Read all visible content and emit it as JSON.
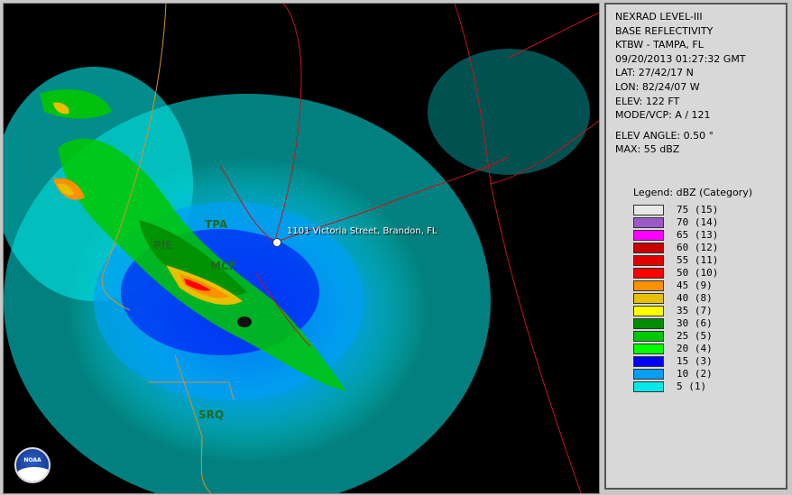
{
  "info": {
    "lines_top": [
      "NEXRAD LEVEL-III",
      "BASE REFLECTIVITY",
      "KTBW - TAMPA, FL",
      "09/20/2013 01:27:32 GMT",
      "LAT: 27/42/17 N",
      "LON: 82/24/07 W",
      "ELEV: 122 FT",
      "MODE/VCP: A / 121"
    ],
    "lines_bottom": [
      "ELEV ANGLE: 0.50 °",
      "MAX: 55 dBZ"
    ]
  },
  "legend": {
    "title": "Legend: dBZ (Category)",
    "items": [
      {
        "label": "75  (15)",
        "color": "#e8e8e8"
      },
      {
        "label": "70  (14)",
        "color": "#9b59c8"
      },
      {
        "label": "65  (13)",
        "color": "#ff00ff"
      },
      {
        "label": "60  (12)",
        "color": "#c80000"
      },
      {
        "label": "55  (11)",
        "color": "#e40000"
      },
      {
        "label": "50  (10)",
        "color": "#ff0000"
      },
      {
        "label": "45  (9)",
        "color": "#ff9000"
      },
      {
        "label": "40  (8)",
        "color": "#e7c000"
      },
      {
        "label": "35  (7)",
        "color": "#ffff00"
      },
      {
        "label": "30  (6)",
        "color": "#008e00"
      },
      {
        "label": "25  (5)",
        "color": "#00c800"
      },
      {
        "label": "20  (4)",
        "color": "#00ff00"
      },
      {
        "label": "15  (3)",
        "color": "#0000f6"
      },
      {
        "label": "10  (2)",
        "color": "#019ff4"
      },
      {
        "label": "5  (1)",
        "color": "#04e9e7"
      }
    ]
  },
  "map": {
    "address": "1101 Victoria Street, Brandon, FL",
    "cities": [
      "TPA",
      "PIE",
      "MCF",
      "SRQ"
    ],
    "logo_text": "NOAA",
    "colors": {
      "road": "#c4141e",
      "county": "#d4922a",
      "background": "#000000"
    }
  }
}
